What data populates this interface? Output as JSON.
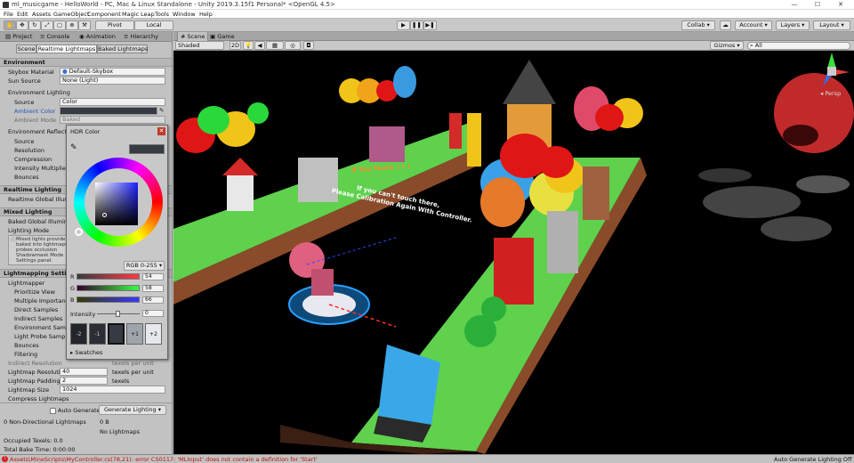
{
  "window": {
    "title": "ml_musicgame - HelloWorld - PC, Mac & Linux Standalone - Unity 2019.3.15f1 Personal* <OpenGL 4.5>",
    "min": "—",
    "max": "☐",
    "close": "✕"
  },
  "menu": [
    "File",
    "Edit",
    "Assets",
    "GameObject",
    "Component",
    "Magic Leap",
    "Tools",
    "Window",
    "Help"
  ],
  "toolbar": {
    "pivot": "Pivot",
    "local": "Local",
    "play": "▶",
    "pause": "❚❚",
    "step": "▶❚",
    "collab": "Collab ▾",
    "account": "Account ▾",
    "layers": "Layers ▾",
    "layout": "Layout ▾"
  },
  "left_tabs": [
    "Project",
    "Console",
    "Animation",
    "Hierarchy"
  ],
  "lighting": {
    "subtabs": [
      "Scene",
      "Realtime Lightmaps",
      "Baked Lightmaps"
    ],
    "environment": {
      "header": "Environment",
      "skybox_label": "Skybox Material",
      "skybox_value": "Default-Skybox",
      "sun_label": "Sun Source",
      "sun_value": "None (Light)",
      "env_lighting": "Environment Lighting",
      "source_label": "Source",
      "source_value": "Color",
      "ambient_color_label": "Ambient Color",
      "ambient_mode_label": "Ambient Mode",
      "ambient_mode_value": "Baked",
      "env_reflections": "Environment Reflections",
      "refl_rows": [
        "Source",
        "Resolution",
        "Compression",
        "Intensity Multiplier",
        "Bounces"
      ]
    },
    "realtime": {
      "header": "Realtime Lighting",
      "gi_label": "Realtime Global Illumination"
    },
    "mixed": {
      "header": "Mixed Lighting",
      "baked_gi": "Baked Global Illumination",
      "mode_label": "Lighting Mode",
      "note": [
        "Mixed lights provide",
        "baked into lightmaps",
        "probes occlusion",
        "Shadowmask Mode",
        "Settings panel."
      ]
    },
    "lightmapping": {
      "header": "Lightmapping Settings",
      "rows": [
        "Lightmapper",
        "Prioritize View",
        "Multiple Importance",
        "Direct Samples",
        "Indirect Samples",
        "Environment Samples",
        "Light Probe Samples",
        "Bounces",
        "Filtering"
      ],
      "indirect_res_label": "Indirect Resolution",
      "indirect_res_unit": "texels per unit",
      "lm_res_label": "Lightmap Resolution",
      "lm_res_value": "40",
      "lm_res_unit": "texels per unit",
      "lm_pad_label": "Lightmap Padding",
      "lm_pad_value": "2",
      "lm_pad_unit": "texels",
      "lm_size_label": "Lightmap Size",
      "lm_size_value": "1024",
      "compress_label": "Compress Lightmaps"
    },
    "footer": {
      "auto_generate": "Auto Generate",
      "generate_btn": "Generate Lighting ▾",
      "stats_label": "0 Non-Directional Lightmaps",
      "stats_value": "0 B",
      "no_lightmaps": "No Lightmaps",
      "occupied": "Occupied Texels: 0.0",
      "bake_time": "Total Bake Time: 0:00:00"
    }
  },
  "hdr": {
    "title": "HDR Color",
    "mode": "RGB 0-255 ▾",
    "r_label": "R",
    "r": "54",
    "g_label": "G",
    "g": "58",
    "b_label": "B",
    "b": "66",
    "intensity_label": "Intensity",
    "intensity": "0",
    "swatch_labels": [
      "-2",
      "-1",
      "",
      "+1",
      "+2"
    ],
    "swatches": "▸ Swatches"
  },
  "scene_tabs": [
    "Scene",
    "Game"
  ],
  "scene_bar": {
    "shading": "Shaded",
    "mode_2d": "2D",
    "gizmos": "Gizmos ▾",
    "search_placeholder": "All",
    "persp": "◂ Persp"
  },
  "scene_text": {
    "line1": "If You Touch ↓↓↓",
    "line2": "If you can't touch there,",
    "line3": "Please Calibration Again With Controller."
  },
  "status": {
    "error": "Assets\\MineScripts\\MyController.cs(78,21): error CS0117: 'MLInput' does not contain a definition for 'Start'",
    "right": "Auto Generate Lighting Off"
  }
}
